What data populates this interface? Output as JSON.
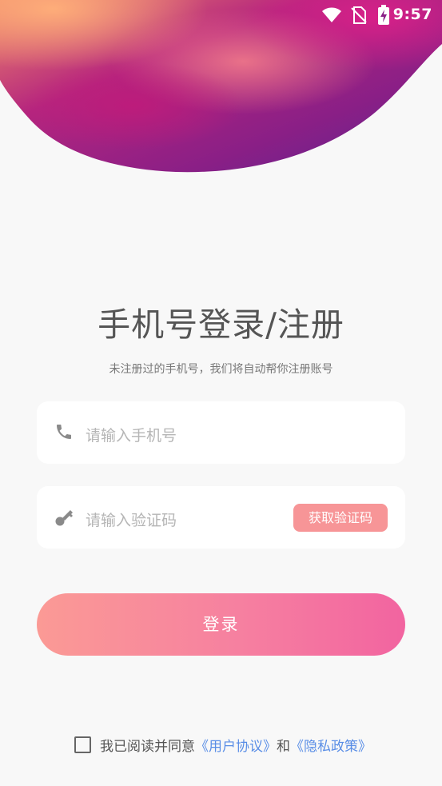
{
  "status_bar": {
    "time": "9:57"
  },
  "header": {
    "title": "手机号登录/注册",
    "subtitle": "未注册过的手机号，我们将自动帮你注册账号"
  },
  "form": {
    "phone_placeholder": "请输入手机号",
    "code_placeholder": "请输入验证码",
    "get_code_label": "获取验证码",
    "login_label": "登录"
  },
  "agreement": {
    "prefix": "我已阅读并同意",
    "user_agreement": "《用户协议》",
    "conjunction": "和",
    "privacy_policy": "《隐私政策》",
    "checked": false
  },
  "colors": {
    "accent_button": "#f79597",
    "login_gradient_start": "#fb9a95",
    "login_gradient_end": "#f264a0",
    "link": "#5a8ee6",
    "background": "#f8f8f8"
  },
  "icons": {
    "status": [
      "wifi-icon",
      "no-sim-icon",
      "battery-charging-icon"
    ],
    "phone_field": "phone-icon",
    "code_field": "key-icon"
  }
}
